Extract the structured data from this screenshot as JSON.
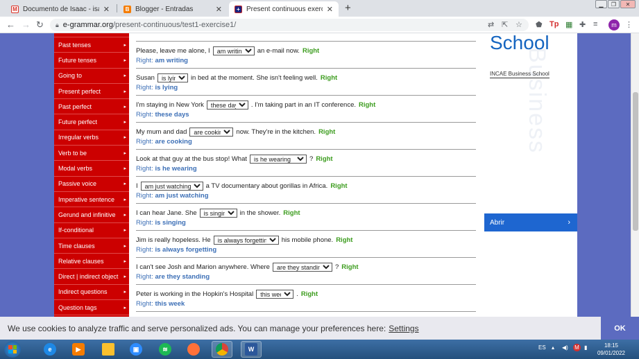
{
  "browser": {
    "tabs": [
      {
        "title": "Documento de Isaac - isaacsanch",
        "favicon": "gmail-icon",
        "active": false
      },
      {
        "title": "Blogger - Entradas",
        "favicon": "blogger-icon",
        "active": false
      },
      {
        "title": "Present continuous exercises Mu",
        "favicon": "uk-flag-icon",
        "active": true
      }
    ],
    "url_host": "e-grammar.org",
    "url_path": "/present-continuous/test1-exercise1/",
    "profile_initial": "m"
  },
  "sidebar": {
    "items": [
      "Past tenses",
      "Future tenses",
      "Going to",
      "Present perfect",
      "Past perfect",
      "Future perfect",
      "Irregular verbs",
      "Verb to be",
      "Modal verbs",
      "Passive voice",
      "Imperative sentence",
      "Gerund and infinitive",
      "If-conditional",
      "Time clauses",
      "Relative clauses",
      "Direct | indirect object",
      "Indirect questions",
      "Question tags"
    ]
  },
  "exercise": {
    "right_label": "Right",
    "answer_prefix": "Right:",
    "questions": [
      {
        "before": "Please, leave me alone, I",
        "select": "am writing",
        "after": "an e-mail now.",
        "answer": "am writing"
      },
      {
        "before": "Susan",
        "select": "is lying",
        "after": "in bed at the moment. She isn't feeling well.",
        "answer": "is lying"
      },
      {
        "before": "I'm staying in New York",
        "select": "these days",
        "after": ". I'm taking part in an IT conference.",
        "answer": "these days"
      },
      {
        "before": "My mum and dad",
        "select": "are cooking",
        "after": "now. They're in the kitchen.",
        "answer": "are cooking"
      },
      {
        "before": "Look at that guy at the bus stop! What",
        "select": "is he wearing",
        "after": "?",
        "answer": "is he wearing"
      },
      {
        "before": "I",
        "select": "am just watching",
        "after": "a TV documentary about gorillas in Africa.",
        "answer": "am just watching"
      },
      {
        "before": "I can hear Jane. She",
        "select": "is singing",
        "after": "in the shower.",
        "answer": "is singing"
      },
      {
        "before": "Jim is really hopeless. He",
        "select": "is always forgetting",
        "after": "his mobile phone.",
        "answer": "is always forgetting"
      },
      {
        "before": "I can't see Josh and Marion anywhere. Where",
        "select": "are they standing",
        "after": "?",
        "answer": "are they standing"
      },
      {
        "before": "Peter is working in the Hopkin's Hospital",
        "select": "this week",
        "after": ".",
        "answer": "this week"
      }
    ]
  },
  "ad": {
    "headline": "School",
    "subline": "INCAE Business School",
    "watermark": "Business",
    "button": "Abrir"
  },
  "cookie": {
    "message": "We use cookies to analyze traffic and serve personalized ads. You can manage your preferences here:",
    "link": "Settings",
    "ok": "OK"
  },
  "taskbar": {
    "lang": "ES",
    "time": "18:15",
    "date": "09/01/2022"
  }
}
